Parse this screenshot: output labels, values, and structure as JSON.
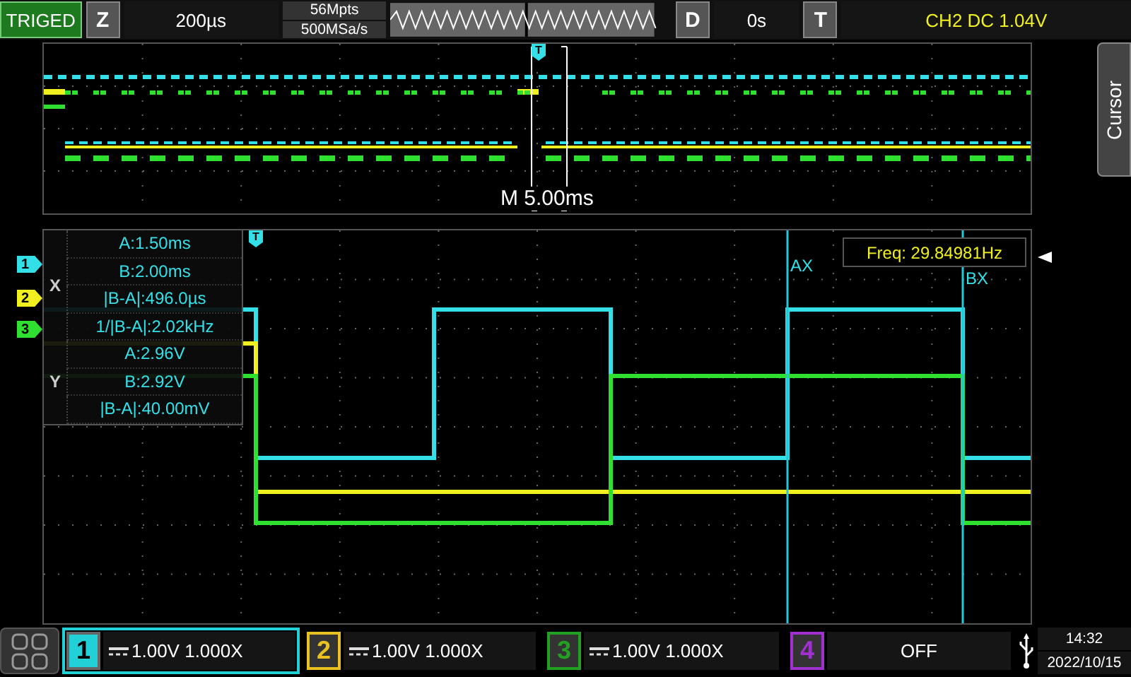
{
  "status": {
    "trigger_state": "TRIGED",
    "zoom_key": "Z",
    "timebase": "200µs",
    "memory_depth": "56Mpts",
    "sample_rate": "500MSa/s",
    "delay_key": "D",
    "delay": "0s",
    "trigger_key": "T",
    "trigger_info": "CH2 DC 1.04V"
  },
  "side_tab": {
    "label": "Cursor"
  },
  "overview": {
    "trigger_marker": "T",
    "window_label": "M 5.00ms"
  },
  "plot": {
    "trigger_marker": "T",
    "frequency": "Freq: 29.84981Hz",
    "cursors": [
      {
        "label": "AX"
      },
      {
        "label": "BX"
      }
    ],
    "channel_markers": [
      {
        "label": "1",
        "color": "#33e0e8"
      },
      {
        "label": "2",
        "color": "#f0f020"
      },
      {
        "label": "3",
        "color": "#30e030"
      }
    ]
  },
  "cursor_readout": {
    "groups": [
      {
        "axis": "X",
        "rows": [
          "A:1.50ms",
          "B:2.00ms",
          "|B-A|:496.0µs",
          "1/|B-A|:2.02kHz"
        ]
      },
      {
        "axis": "Y",
        "rows": [
          "A:2.96V",
          "B:2.92V",
          "|B-A|:40.00mV"
        ]
      }
    ]
  },
  "channels": [
    {
      "number": "1",
      "selected": true,
      "on": true,
      "color": "#22d0d8",
      "setting": "1.00V 1.000X"
    },
    {
      "number": "2",
      "selected": false,
      "on": true,
      "color": "#e8c020",
      "setting": "1.00V 1.000X"
    },
    {
      "number": "3",
      "selected": false,
      "on": true,
      "color": "#22a022",
      "setting": "1.00V 1.000X"
    },
    {
      "number": "4",
      "selected": false,
      "on": false,
      "color": "#a030d0",
      "setting": "OFF"
    }
  ],
  "clock": {
    "time": "14:32",
    "date": "2022/10/15"
  }
}
